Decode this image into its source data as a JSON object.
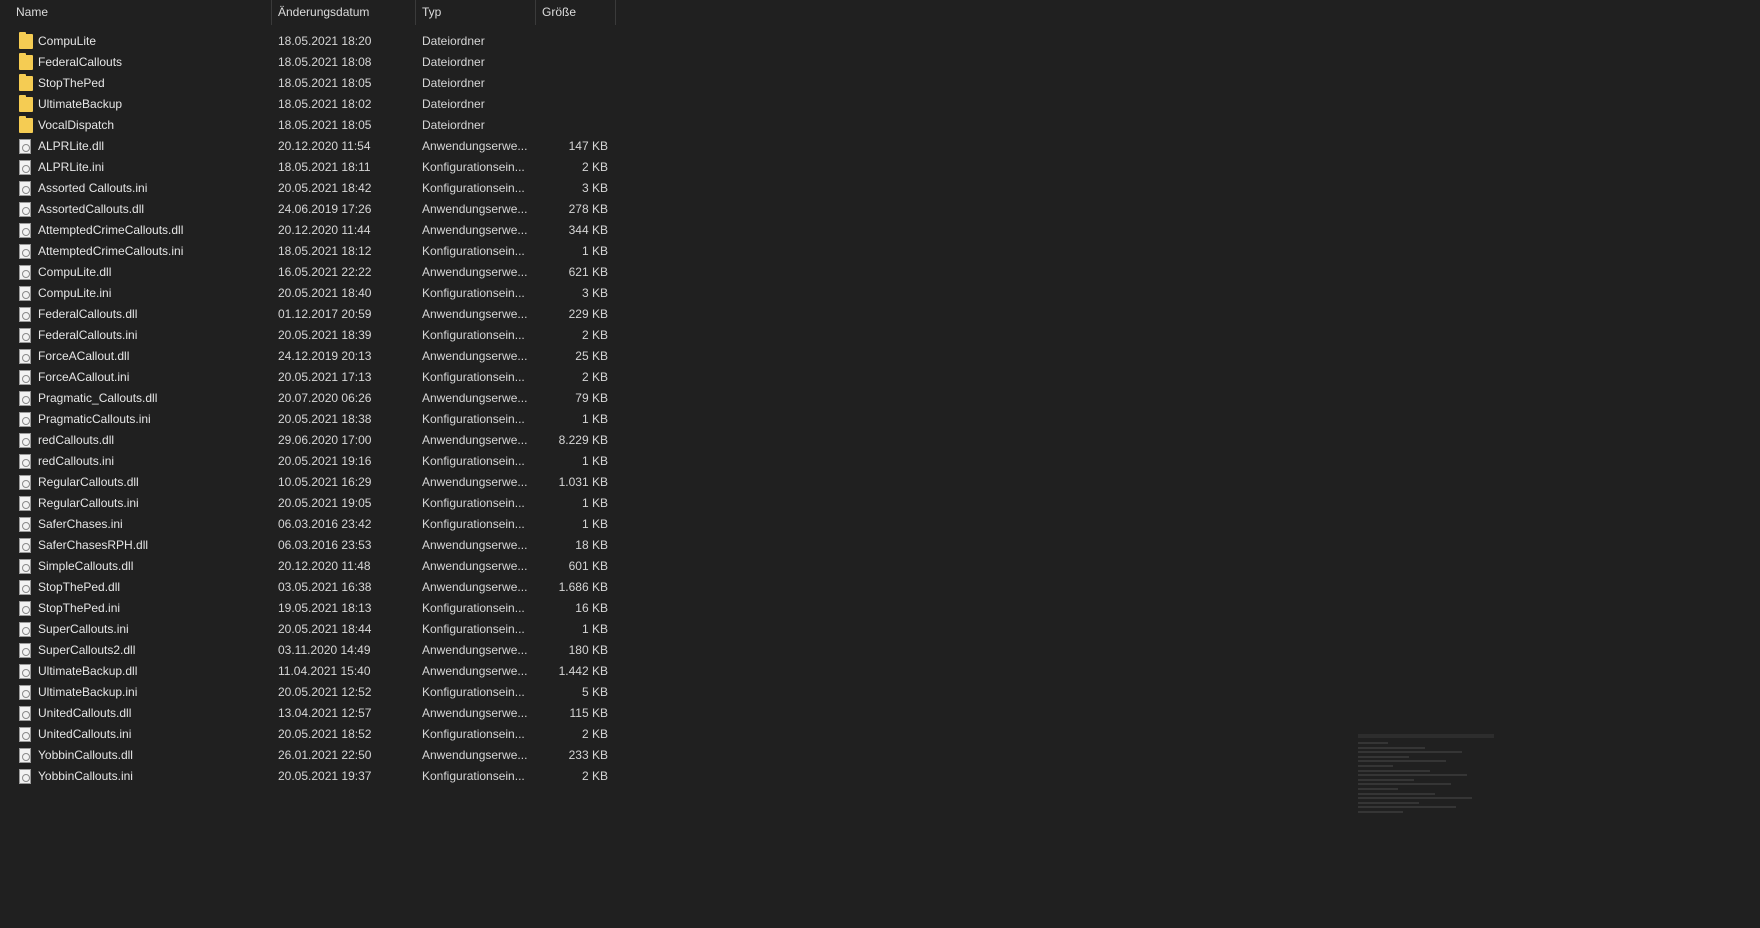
{
  "columns": {
    "name": "Name",
    "date": "Änderungsdatum",
    "type": "Typ",
    "size": "Größe"
  },
  "sort_indicator": "^",
  "files": [
    {
      "name": "CompuLite",
      "date": "18.05.2021 18:20",
      "type": "Dateiordner",
      "size": "",
      "icon": "folder-icon"
    },
    {
      "name": "FederalCallouts",
      "date": "18.05.2021 18:08",
      "type": "Dateiordner",
      "size": "",
      "icon": "folder-icon"
    },
    {
      "name": "StopThePed",
      "date": "18.05.2021 18:05",
      "type": "Dateiordner",
      "size": "",
      "icon": "folder-icon"
    },
    {
      "name": "UltimateBackup",
      "date": "18.05.2021 18:02",
      "type": "Dateiordner",
      "size": "",
      "icon": "folder-icon"
    },
    {
      "name": "VocalDispatch",
      "date": "18.05.2021 18:05",
      "type": "Dateiordner",
      "size": "",
      "icon": "folder-icon"
    },
    {
      "name": "ALPRLite.dll",
      "date": "20.12.2020 11:54",
      "type": "Anwendungserwe...",
      "size": "147 KB",
      "icon": "file-icon"
    },
    {
      "name": "ALPRLite.ini",
      "date": "18.05.2021 18:11",
      "type": "Konfigurationsein...",
      "size": "2 KB",
      "icon": "file-icon"
    },
    {
      "name": "Assorted Callouts.ini",
      "date": "20.05.2021 18:42",
      "type": "Konfigurationsein...",
      "size": "3 KB",
      "icon": "file-icon"
    },
    {
      "name": "AssortedCallouts.dll",
      "date": "24.06.2019 17:26",
      "type": "Anwendungserwe...",
      "size": "278 KB",
      "icon": "file-icon"
    },
    {
      "name": "AttemptedCrimeCallouts.dll",
      "date": "20.12.2020 11:44",
      "type": "Anwendungserwe...",
      "size": "344 KB",
      "icon": "file-icon"
    },
    {
      "name": "AttemptedCrimeCallouts.ini",
      "date": "18.05.2021 18:12",
      "type": "Konfigurationsein...",
      "size": "1 KB",
      "icon": "file-icon"
    },
    {
      "name": "CompuLite.dll",
      "date": "16.05.2021 22:22",
      "type": "Anwendungserwe...",
      "size": "621 KB",
      "icon": "file-icon"
    },
    {
      "name": "CompuLite.ini",
      "date": "20.05.2021 18:40",
      "type": "Konfigurationsein...",
      "size": "3 KB",
      "icon": "file-icon"
    },
    {
      "name": "FederalCallouts.dll",
      "date": "01.12.2017 20:59",
      "type": "Anwendungserwe...",
      "size": "229 KB",
      "icon": "file-icon"
    },
    {
      "name": "FederalCallouts.ini",
      "date": "20.05.2021 18:39",
      "type": "Konfigurationsein...",
      "size": "2 KB",
      "icon": "file-icon"
    },
    {
      "name": "ForceACallout.dll",
      "date": "24.12.2019 20:13",
      "type": "Anwendungserwe...",
      "size": "25 KB",
      "icon": "file-icon"
    },
    {
      "name": "ForceACallout.ini",
      "date": "20.05.2021 17:13",
      "type": "Konfigurationsein...",
      "size": "2 KB",
      "icon": "file-icon"
    },
    {
      "name": "Pragmatic_Callouts.dll",
      "date": "20.07.2020 06:26",
      "type": "Anwendungserwe...",
      "size": "79 KB",
      "icon": "file-icon"
    },
    {
      "name": "PragmaticCallouts.ini",
      "date": "20.05.2021 18:38",
      "type": "Konfigurationsein...",
      "size": "1 KB",
      "icon": "file-icon"
    },
    {
      "name": "redCallouts.dll",
      "date": "29.06.2020 17:00",
      "type": "Anwendungserwe...",
      "size": "8.229 KB",
      "icon": "file-icon"
    },
    {
      "name": "redCallouts.ini",
      "date": "20.05.2021 19:16",
      "type": "Konfigurationsein...",
      "size": "1 KB",
      "icon": "file-icon"
    },
    {
      "name": "RegularCallouts.dll",
      "date": "10.05.2021 16:29",
      "type": "Anwendungserwe...",
      "size": "1.031 KB",
      "icon": "file-icon"
    },
    {
      "name": "RegularCallouts.ini",
      "date": "20.05.2021 19:05",
      "type": "Konfigurationsein...",
      "size": "1 KB",
      "icon": "file-icon"
    },
    {
      "name": "SaferChases.ini",
      "date": "06.03.2016 23:42",
      "type": "Konfigurationsein...",
      "size": "1 KB",
      "icon": "file-icon"
    },
    {
      "name": "SaferChasesRPH.dll",
      "date": "06.03.2016 23:53",
      "type": "Anwendungserwe...",
      "size": "18 KB",
      "icon": "file-icon"
    },
    {
      "name": "SimpleCallouts.dll",
      "date": "20.12.2020 11:48",
      "type": "Anwendungserwe...",
      "size": "601 KB",
      "icon": "file-icon"
    },
    {
      "name": "StopThePed.dll",
      "date": "03.05.2021 16:38",
      "type": "Anwendungserwe...",
      "size": "1.686 KB",
      "icon": "file-icon"
    },
    {
      "name": "StopThePed.ini",
      "date": "19.05.2021 18:13",
      "type": "Konfigurationsein...",
      "size": "16 KB",
      "icon": "file-icon"
    },
    {
      "name": "SuperCallouts.ini",
      "date": "20.05.2021 18:44",
      "type": "Konfigurationsein...",
      "size": "1 KB",
      "icon": "file-icon"
    },
    {
      "name": "SuperCallouts2.dll",
      "date": "03.11.2020 14:49",
      "type": "Anwendungserwe...",
      "size": "180 KB",
      "icon": "file-icon"
    },
    {
      "name": "UltimateBackup.dll",
      "date": "11.04.2021 15:40",
      "type": "Anwendungserwe...",
      "size": "1.442 KB",
      "icon": "file-icon"
    },
    {
      "name": "UltimateBackup.ini",
      "date": "20.05.2021 12:52",
      "type": "Konfigurationsein...",
      "size": "5 KB",
      "icon": "file-icon"
    },
    {
      "name": "UnitedCallouts.dll",
      "date": "13.04.2021 12:57",
      "type": "Anwendungserwe...",
      "size": "115 KB",
      "icon": "file-icon"
    },
    {
      "name": "UnitedCallouts.ini",
      "date": "20.05.2021 18:52",
      "type": "Konfigurationsein...",
      "size": "2 KB",
      "icon": "file-icon"
    },
    {
      "name": "YobbinCallouts.dll",
      "date": "26.01.2021 22:50",
      "type": "Anwendungserwe...",
      "size": "233 KB",
      "icon": "file-icon"
    },
    {
      "name": "YobbinCallouts.ini",
      "date": "20.05.2021 19:37",
      "type": "Konfigurationsein...",
      "size": "2 KB",
      "icon": "file-icon"
    }
  ],
  "colors": {
    "background": "#202020",
    "folder": "#f5cc53",
    "text": "#e6e6e6"
  }
}
